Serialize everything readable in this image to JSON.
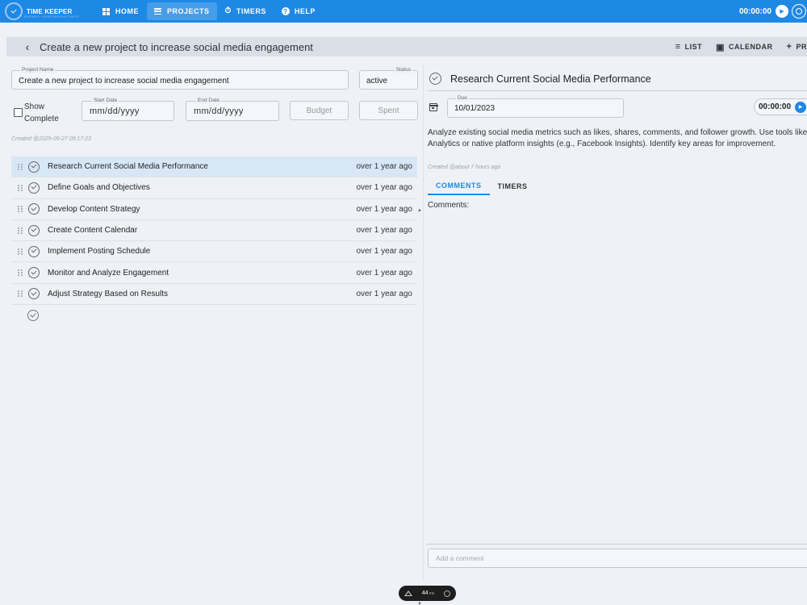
{
  "app": {
    "logo_text": "TIME KEEPER",
    "logo_subtext": "ELEVATE YOUR PRODUCTIVITY",
    "nav": [
      {
        "label": "HOME",
        "icon": "grid-icon",
        "active": false
      },
      {
        "label": "PROJECTS",
        "icon": "list-icon",
        "active": true
      },
      {
        "label": "TIMERS",
        "icon": "stopwatch-icon",
        "active": false
      },
      {
        "label": "HELP",
        "icon": "help-icon",
        "active": false
      }
    ],
    "timer": "00:00:00",
    "accent_color": "#1e88e5"
  },
  "header": {
    "title": "Create a new project to increase social media engagement",
    "actions": [
      {
        "label": "LIST",
        "icon": "list-icon"
      },
      {
        "label": "CALENDAR",
        "icon": "calendar-icon"
      },
      {
        "label": "PR",
        "icon": "plus-icon"
      }
    ]
  },
  "project": {
    "name_label": "Project Name",
    "name_value": "Create a new project to increase social media engagement",
    "status_label": "Status",
    "status_value": "active",
    "show_complete_label": "Show Complete",
    "start_date_label": "Start Date",
    "start_date_value": "mm/dd/yyyy",
    "end_date_label": "End Date",
    "end_date_value": "mm/dd/yyyy",
    "budget_placeholder": "Budget",
    "spent_placeholder": "Spent",
    "created": "Created @2025-05-27 09:17:23"
  },
  "tasks": [
    {
      "name": "Research Current Social Media Performance",
      "time": "over 1 year ago",
      "selected": true
    },
    {
      "name": "Define Goals and Objectives",
      "time": "over 1 year ago",
      "selected": false
    },
    {
      "name": "Develop Content Strategy",
      "time": "over 1 year ago",
      "selected": false
    },
    {
      "name": "Create Content Calendar",
      "time": "over 1 year ago",
      "selected": false
    },
    {
      "name": "Implement Posting Schedule",
      "time": "over 1 year ago",
      "selected": false
    },
    {
      "name": "Monitor and Analyze Engagement",
      "time": "over 1 year ago",
      "selected": false
    },
    {
      "name": "Adjust Strategy Based on Results",
      "time": "over 1 year ago",
      "selected": false
    }
  ],
  "detail": {
    "title": "Research Current Social Media Performance",
    "due_label": "Due",
    "due_value": "10/01/2023",
    "timer": "00:00:00",
    "description_line1": "Analyze existing social media metrics such as likes, shares, comments, and follower growth. Use tools like Google",
    "description_line2": "Analytics or native platform insights (e.g., Facebook Insights). Identify key areas for improvement.",
    "created": "Created @about 7 hours ago",
    "tabs": [
      {
        "label": "COMMENTS",
        "active": true
      },
      {
        "label": "TIMERS",
        "active": false
      }
    ],
    "comments_label": "Comments:",
    "comment_placeholder": "Add a comment"
  },
  "perf": {
    "value": "44",
    "unit": "ms"
  }
}
